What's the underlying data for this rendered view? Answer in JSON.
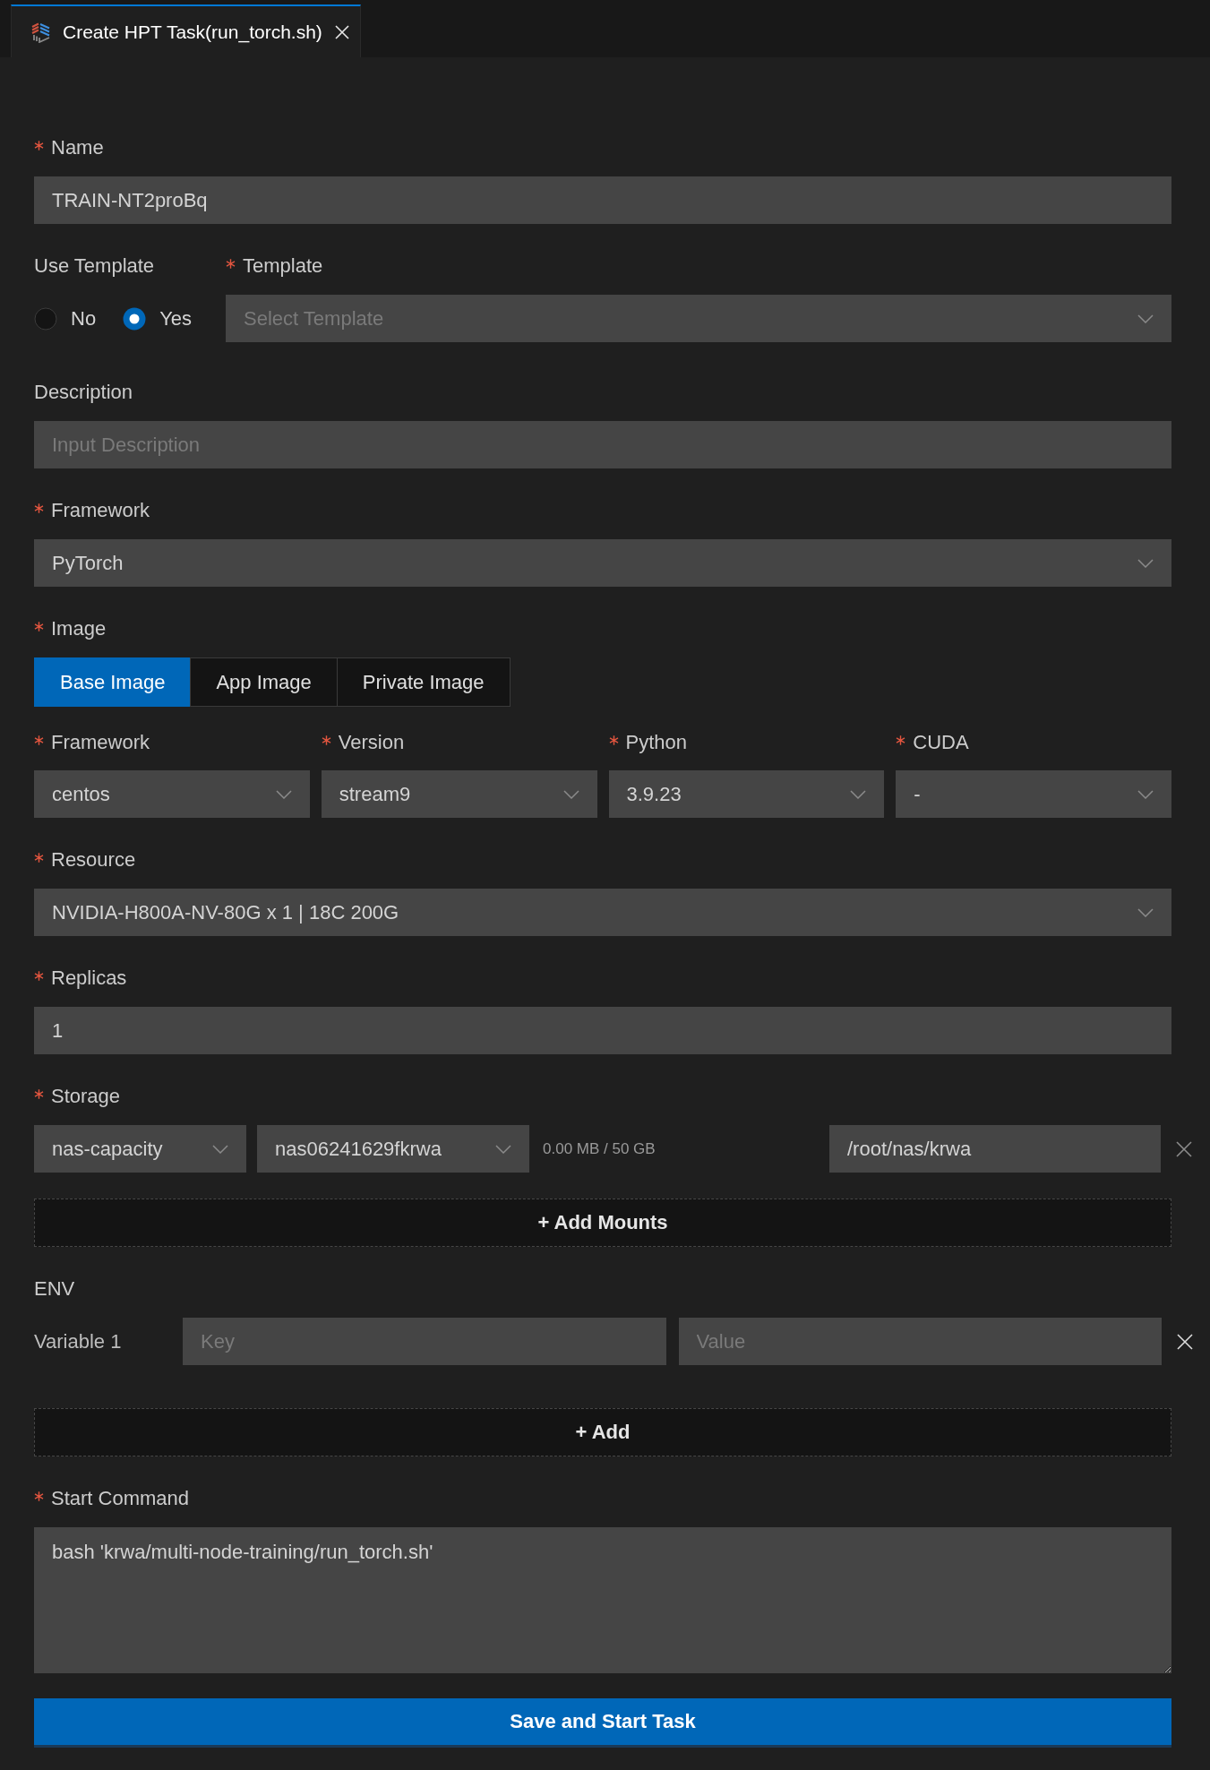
{
  "tab": {
    "title": "Create HPT Task(run_torch.sh)",
    "selected": true
  },
  "fields": [
    {
      "kind": "input",
      "label": "Name",
      "required": true,
      "value": "TRAIN-NT2proBq"
    },
    {
      "kind": "template",
      "label": "Use Template",
      "required": false,
      "options": [
        {
          "label": "No",
          "selected": false
        },
        {
          "label": "Yes",
          "selected": true
        }
      ],
      "select": {
        "label": "Template",
        "required": true,
        "placeholder": "Select Template"
      }
    },
    {
      "kind": "input",
      "label": "Description",
      "required": false,
      "placeholder": "Input Description"
    },
    {
      "kind": "select",
      "label": "Framework",
      "required": true,
      "value": "PyTorch"
    },
    {
      "kind": "image",
      "label": "Image",
      "required": true,
      "tabs": [
        {
          "label": "Base Image",
          "selected": true
        },
        {
          "label": "App Image",
          "selected": false
        },
        {
          "label": "Private Image",
          "selected": false
        }
      ],
      "selects": [
        {
          "label": "Framework",
          "required": true,
          "value": "centos"
        },
        {
          "label": "Version",
          "required": true,
          "value": "stream9"
        },
        {
          "label": "Python",
          "required": true,
          "value": "3.9.23"
        },
        {
          "label": "CUDA",
          "required": true,
          "value": "-"
        }
      ]
    },
    {
      "kind": "select",
      "label": "Resource",
      "required": true,
      "value": "NVIDIA-H800A-NV-80G x 1 | 18C 200G"
    },
    {
      "kind": "input",
      "label": "Replicas",
      "required": true,
      "value": "1"
    },
    {
      "kind": "storage",
      "label": "Storage",
      "required": true,
      "mounts": [
        {
          "type": "nas-capacity",
          "volume": "nas06241629fkrwa",
          "usage": "0.00 MB / 50 GB",
          "path": "/root/nas/krwa"
        }
      ],
      "add_button": "+ Add Mounts"
    },
    {
      "kind": "env",
      "label": "ENV",
      "required": false,
      "variables": [
        {
          "name": "Variable 1",
          "key_placeholder": "Key",
          "value_placeholder": "Value"
        }
      ],
      "add_button": "+ Add"
    },
    {
      "kind": "textarea",
      "label": "Start Command",
      "required": true,
      "value": "bash 'krwa/multi-node-training/run_torch.sh'"
    }
  ],
  "submit": "Save and Start Task"
}
